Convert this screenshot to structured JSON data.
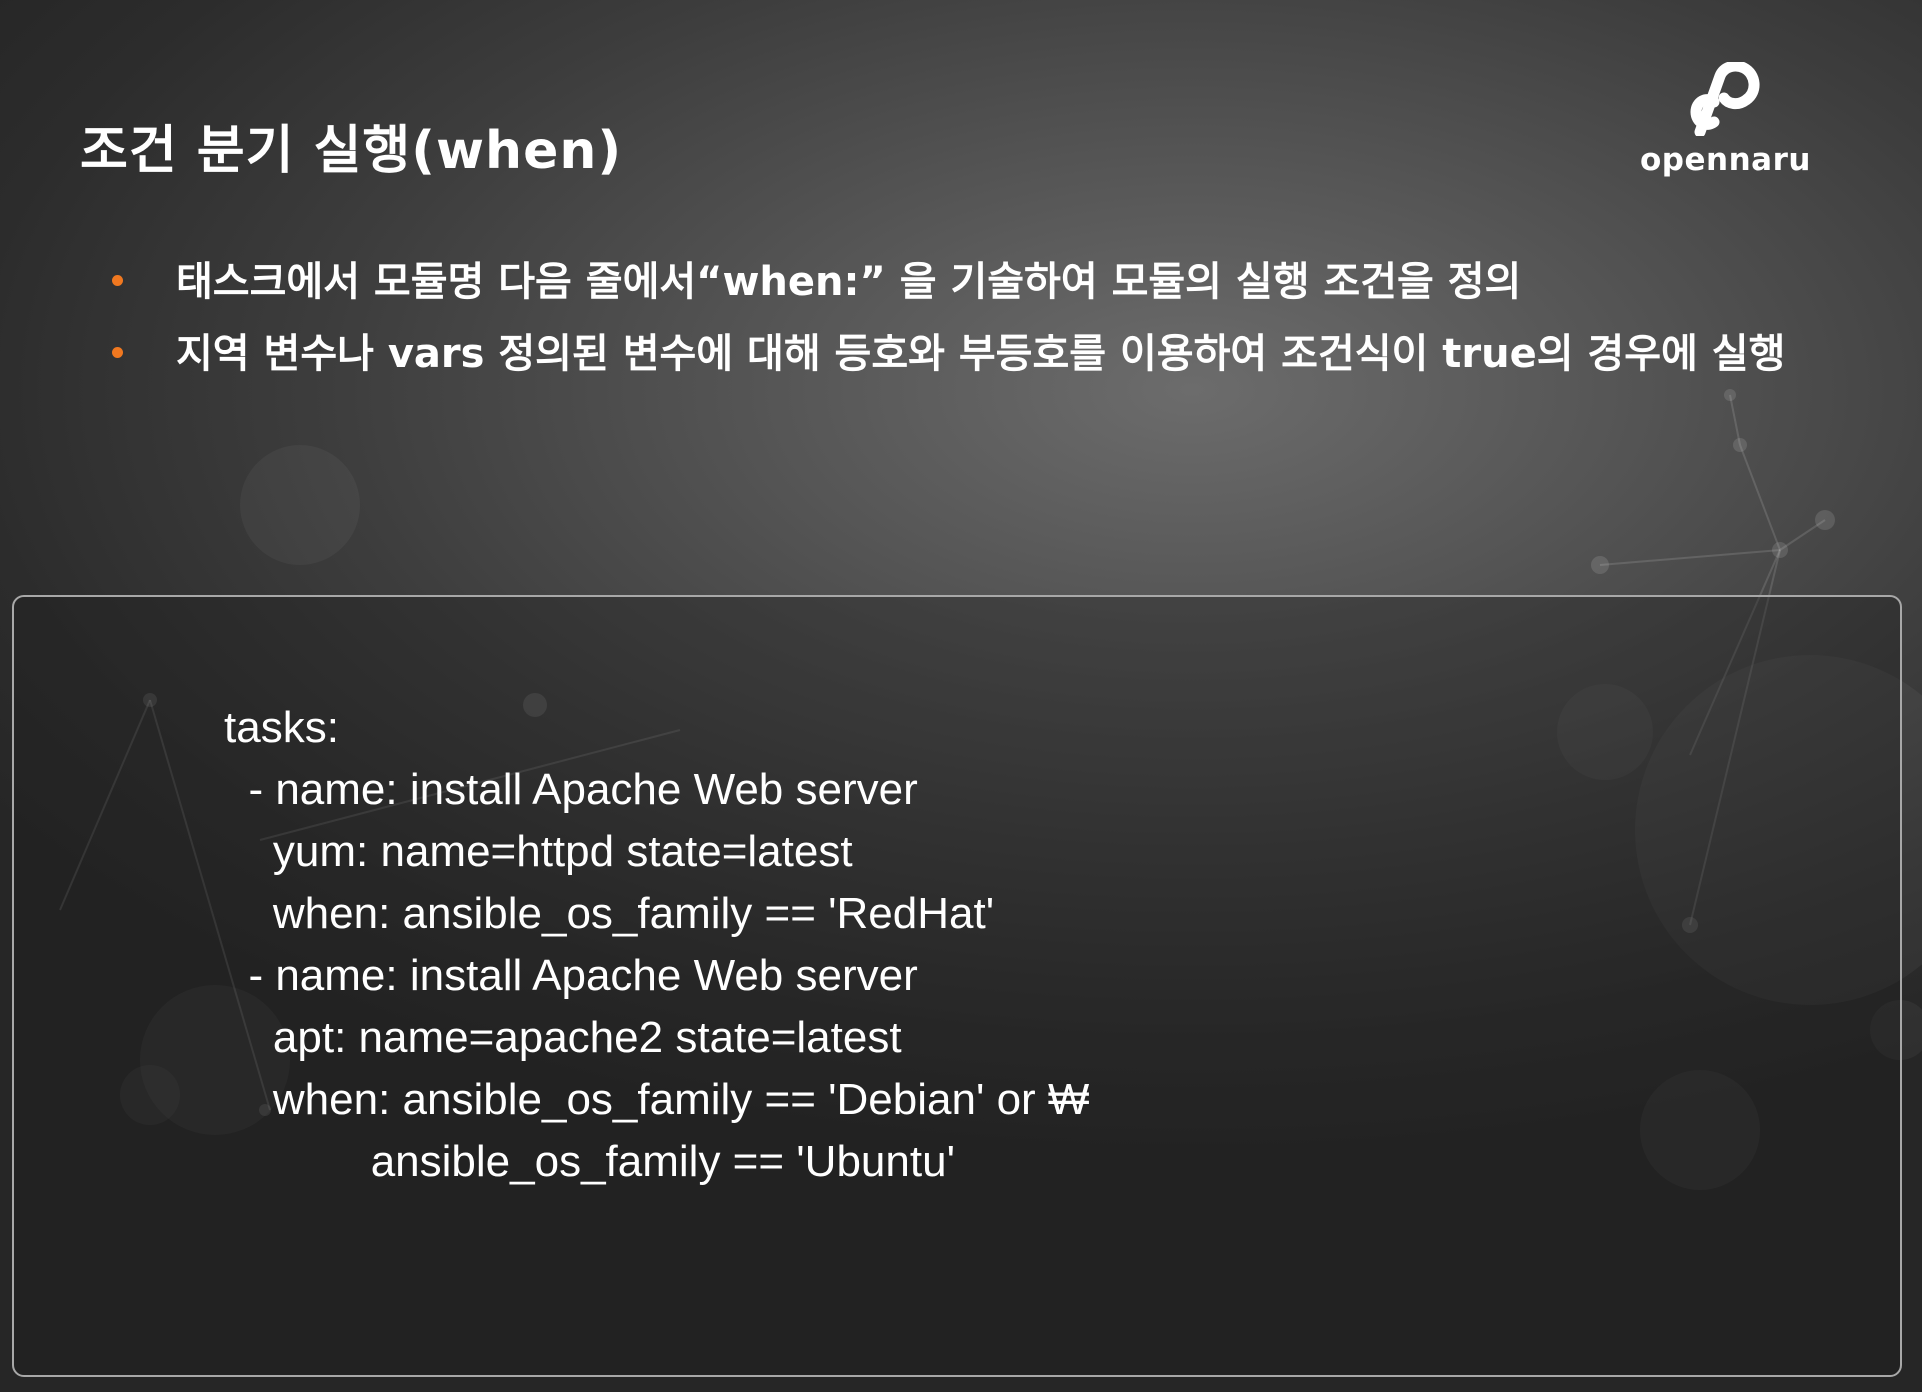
{
  "slide": {
    "title": "조건 분기 실행(when)"
  },
  "logo": {
    "icon": "opennaru-logo-icon",
    "text": "opennaru"
  },
  "bullets": [
    "태스크에서 모듈명 다음 줄에서“when:” 을 기술하여 모듈의 실행 조건을 정의",
    "지역 변수나 vars 정의된 변수에 대해 등호와 부등호를 이용하여 조건식이 true의 경우에 실행"
  ],
  "code": {
    "lines": [
      "tasks:",
      "  - name: install Apache Web server",
      "    yum: name=httpd state=latest",
      "    when: ansible_os_family == 'RedHat'",
      "  - name: install Apache Web server",
      "    apt: name=apache2 state=latest",
      "    when: ansible_os_family == 'Debian' or ₩",
      "            ansible_os_family == 'Ubuntu'"
    ]
  },
  "colors": {
    "bullet_accent": "#f07820",
    "text": "#ffffff",
    "panel_border": "#a8a8a8"
  }
}
